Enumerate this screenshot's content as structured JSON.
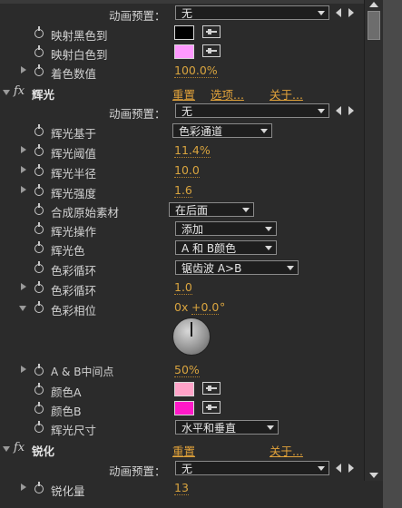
{
  "header": {
    "preset_label": "动画预置：",
    "preset_value": "无"
  },
  "top_group": [
    {
      "label": "映射黑色到",
      "color": "#000000"
    },
    {
      "label": "映射白色到",
      "color": "#ff99ff"
    },
    {
      "label": "着色数值",
      "value": "100.0%"
    }
  ],
  "glow": {
    "name": "辉光",
    "reset": "重置",
    "options": "选项...",
    "about": "关于...",
    "preset_label": "动画预置：",
    "preset_value": "无",
    "props": [
      {
        "label": "辉光基于",
        "dropdown": "色彩通道"
      },
      {
        "label": "辉光阈值",
        "value": "11.4%"
      },
      {
        "label": "辉光半径",
        "value": "10.0"
      },
      {
        "label": "辉光强度",
        "value": "1.6"
      },
      {
        "label": "合成原始素材",
        "dropdown": "在后面"
      },
      {
        "label": "辉光操作",
        "dropdown": "添加"
      },
      {
        "label": "辉光色",
        "dropdown": "A 和 B颜色"
      },
      {
        "label": "色彩循环",
        "dropdown": "锯齿波 A>B"
      },
      {
        "label": "色彩循环",
        "value": "1.0"
      },
      {
        "label": "色彩相位",
        "value_prefix": "0x",
        "value": "+0.0",
        "value_suffix": "°"
      },
      {
        "label": "A & B中间点",
        "value": "50%"
      },
      {
        "label": "颜色A",
        "color": "#ffa3c8"
      },
      {
        "label": "颜色B",
        "color": "#ff19c8"
      },
      {
        "label": "辉光尺寸",
        "dropdown": "水平和垂直"
      }
    ]
  },
  "sharpen": {
    "name": "锐化",
    "reset": "重置",
    "about": "关于...",
    "preset_label": "动画预置：",
    "preset_value": "无",
    "props": [
      {
        "label": "锐化量",
        "value": "13"
      }
    ]
  },
  "icons": {
    "fx": "fx",
    "stopwatch": "stopwatch-icon",
    "eyedropper": "eyedropper-icon"
  }
}
